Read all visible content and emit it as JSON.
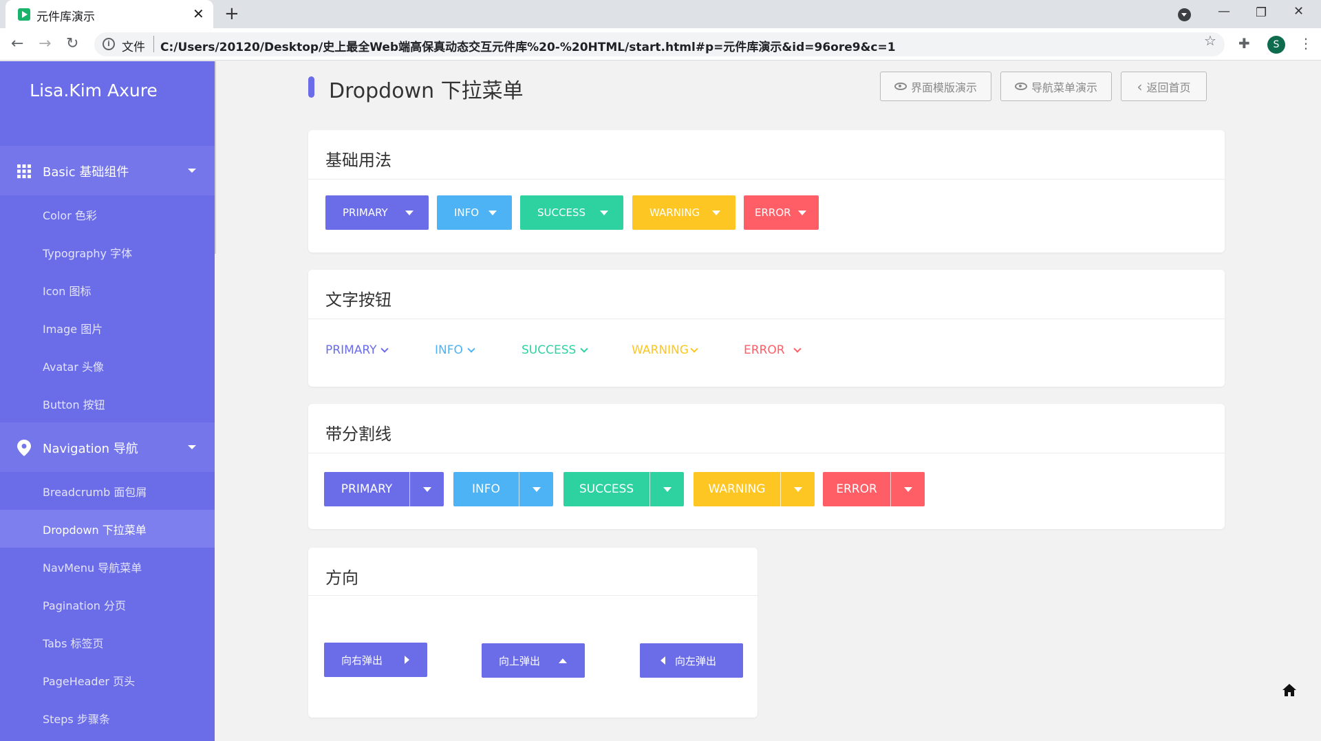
{
  "browser": {
    "tab_title": "元件库演示",
    "tab_close": "✕",
    "new_tab": "+",
    "file_label": "文件",
    "url": "C:/Users/20120/Desktop/史上最全Web端高保真动态交互元件库%20-%20HTML/start.html#p=元件库演示&id=96ore9&c=1",
    "profile_initial": "S"
  },
  "sidebar": {
    "brand": "Lisa.Kim Axure",
    "groups": [
      {
        "label": "Basic 基础组件",
        "icon": "grid-icon"
      },
      {
        "label": "Navigation 导航",
        "icon": "location-pin-icon"
      }
    ],
    "basic_items": [
      "Color 色彩",
      "Typography 字体",
      "Icon 图标",
      "Image 图片",
      "Avatar 头像",
      "Button 按钮"
    ],
    "nav_items": [
      "Breadcrumb 面包屑",
      "Dropdown 下拉菜单",
      "NavMenu 导航菜单",
      "Pagination 分页",
      "Tabs 标签页",
      "PageHeader 页头",
      "Steps 步骤条"
    ],
    "active_item": "Dropdown 下拉菜单"
  },
  "header": {
    "title": "Dropdown 下拉菜单",
    "buttons": [
      "界面模版演示",
      "导航菜单演示",
      "返回首页"
    ]
  },
  "colors": {
    "primary": "#6b6de8",
    "info": "#4db3f5",
    "success": "#2ed2a1",
    "warning": "#fdc623",
    "error": "#ff5e66"
  },
  "sections": {
    "basic": {
      "title": "基础用法",
      "buttons": [
        "PRIMARY",
        "INFO",
        "SUCCESS",
        "WARNING",
        "ERROR"
      ]
    },
    "text": {
      "title": "文字按钮",
      "buttons": [
        "PRIMARY",
        "INFO",
        "SUCCESS",
        "WARNING",
        "ERROR"
      ]
    },
    "split": {
      "title": "带分割线",
      "buttons": [
        "PRIMARY",
        "INFO",
        "SUCCESS",
        "WARNING",
        "ERROR"
      ]
    },
    "direction": {
      "title": "方向",
      "buttons": [
        "向右弹出",
        "向上弹出",
        "向左弹出"
      ]
    }
  }
}
